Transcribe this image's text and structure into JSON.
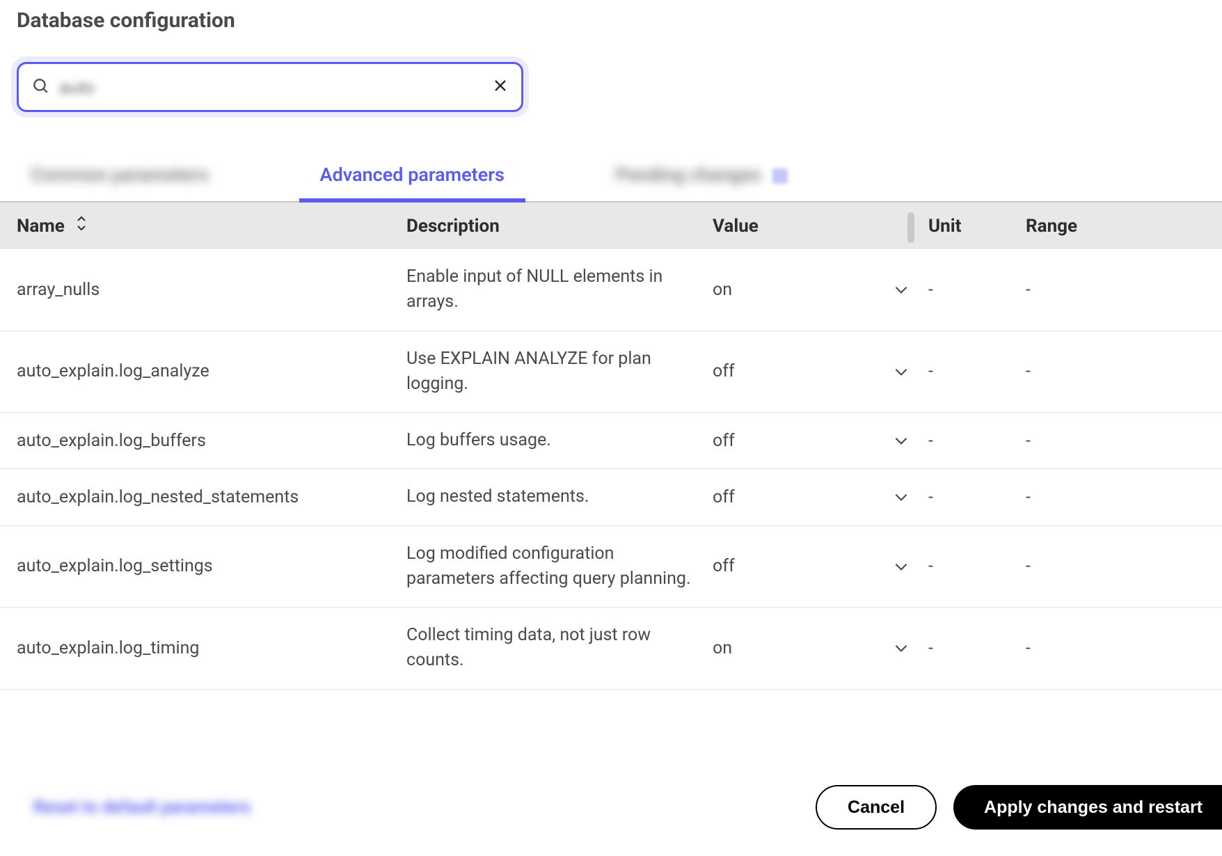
{
  "page_title": "Database configuration",
  "search": {
    "value": "auto",
    "placeholder": ""
  },
  "tabs": {
    "items": [
      {
        "label": "Common parameters",
        "active": false,
        "blurred": true
      },
      {
        "label": "Advanced parameters",
        "active": true,
        "blurred": false
      },
      {
        "label": "Pending changes",
        "active": false,
        "blurred": true,
        "has_badge": true
      }
    ]
  },
  "columns": {
    "name": "Name",
    "description": "Description",
    "value": "Value",
    "unit": "Unit",
    "range": "Range"
  },
  "rows": [
    {
      "name": "array_nulls",
      "description": "Enable input of NULL elements in arrays.",
      "value": "on",
      "unit": "-",
      "range": "-"
    },
    {
      "name": "auto_explain.log_analyze",
      "description": "Use EXPLAIN ANALYZE for plan logging.",
      "value": "off",
      "unit": "-",
      "range": "-"
    },
    {
      "name": "auto_explain.log_buffers",
      "description": "Log buffers usage.",
      "value": "off",
      "unit": "-",
      "range": "-"
    },
    {
      "name": "auto_explain.log_nested_statements",
      "description": "Log nested statements.",
      "value": "off",
      "unit": "-",
      "range": "-"
    },
    {
      "name": "auto_explain.log_settings",
      "description": "Log modified configuration parameters affecting query planning.",
      "value": "off",
      "unit": "-",
      "range": "-"
    },
    {
      "name": "auto_explain.log_timing",
      "description": "Collect timing data, not just row counts.",
      "value": "on",
      "unit": "-",
      "range": "-"
    }
  ],
  "footer": {
    "reset": "Reset to default parameters",
    "cancel": "Cancel",
    "apply": "Apply changes and restart"
  }
}
